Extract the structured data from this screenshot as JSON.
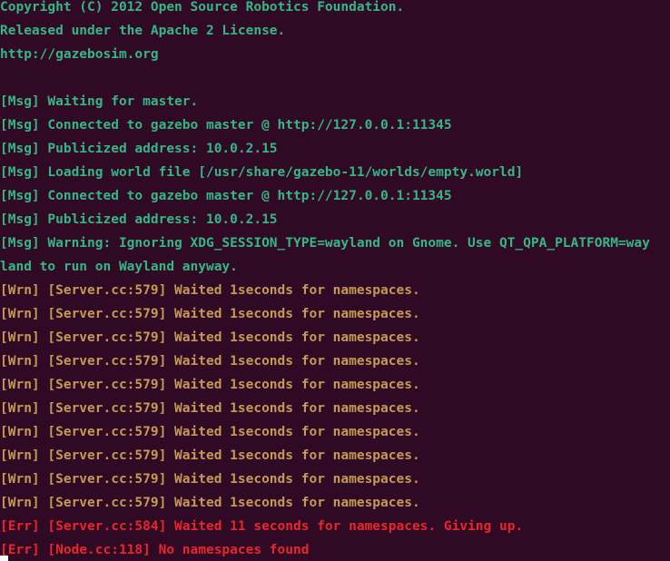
{
  "colors": {
    "background": "#300a24",
    "info": "#35b785",
    "warning": "#c49a54",
    "error": "#e8262c",
    "cursor": "#ffffff"
  },
  "lines": [
    {
      "text": "Copyright (C) 2012 Open Source Robotics Foundation.",
      "level": "info"
    },
    {
      "text": "Released under the Apache 2 License.",
      "level": "info"
    },
    {
      "text": "http://gazebosim.org",
      "level": "info"
    },
    {
      "text": "",
      "level": "info"
    },
    {
      "text": "[Msg] Waiting for master.",
      "level": "info"
    },
    {
      "text": "[Msg] Connected to gazebo master @ http://127.0.0.1:11345",
      "level": "info"
    },
    {
      "text": "[Msg] Publicized address: 10.0.2.15",
      "level": "info"
    },
    {
      "text": "[Msg] Loading world file [/usr/share/gazebo-11/worlds/empty.world]",
      "level": "info"
    },
    {
      "text": "[Msg] Connected to gazebo master @ http://127.0.0.1:11345",
      "level": "info"
    },
    {
      "text": "[Msg] Publicized address: 10.0.2.15",
      "level": "info"
    },
    {
      "text": "[Msg] Warning: Ignoring XDG_SESSION_TYPE=wayland on Gnome. Use QT_QPA_PLATFORM=way",
      "level": "info"
    },
    {
      "text": "land to run on Wayland anyway.",
      "level": "info"
    },
    {
      "text": "[Wrn] [Server.cc:579] Waited 1seconds for namespaces.",
      "level": "warning"
    },
    {
      "text": "[Wrn] [Server.cc:579] Waited 1seconds for namespaces.",
      "level": "warning"
    },
    {
      "text": "[Wrn] [Server.cc:579] Waited 1seconds for namespaces.",
      "level": "warning"
    },
    {
      "text": "[Wrn] [Server.cc:579] Waited 1seconds for namespaces.",
      "level": "warning"
    },
    {
      "text": "[Wrn] [Server.cc:579] Waited 1seconds for namespaces.",
      "level": "warning"
    },
    {
      "text": "[Wrn] [Server.cc:579] Waited 1seconds for namespaces.",
      "level": "warning"
    },
    {
      "text": "[Wrn] [Server.cc:579] Waited 1seconds for namespaces.",
      "level": "warning"
    },
    {
      "text": "[Wrn] [Server.cc:579] Waited 1seconds for namespaces.",
      "level": "warning"
    },
    {
      "text": "[Wrn] [Server.cc:579] Waited 1seconds for namespaces.",
      "level": "warning"
    },
    {
      "text": "[Wrn] [Server.cc:579] Waited 1seconds for namespaces.",
      "level": "warning"
    },
    {
      "text": "[Err] [Server.cc:584] Waited 11 seconds for namespaces. Giving up.",
      "level": "error"
    },
    {
      "text": "[Err] [Node.cc:118] No namespaces found",
      "level": "error"
    }
  ]
}
